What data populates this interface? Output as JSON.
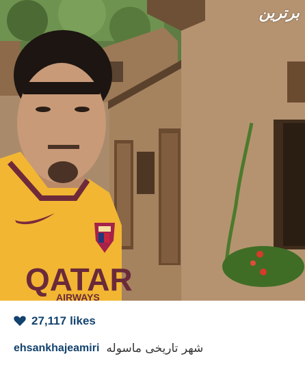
{
  "post": {
    "watermark": "برترین",
    "likes_count": "27,117",
    "likes_label": "likes",
    "username": "ehsankhajeamiri",
    "caption": "شهر تاریخی ماسوله"
  },
  "jersey": {
    "sponsor_text": "QATAR",
    "sponsor_sub": "AIRWAYS"
  },
  "colors": {
    "accent": "#12426e",
    "jersey": "#f2b632",
    "wall": "#b59371"
  },
  "icons": {
    "likes": "heart-icon"
  }
}
